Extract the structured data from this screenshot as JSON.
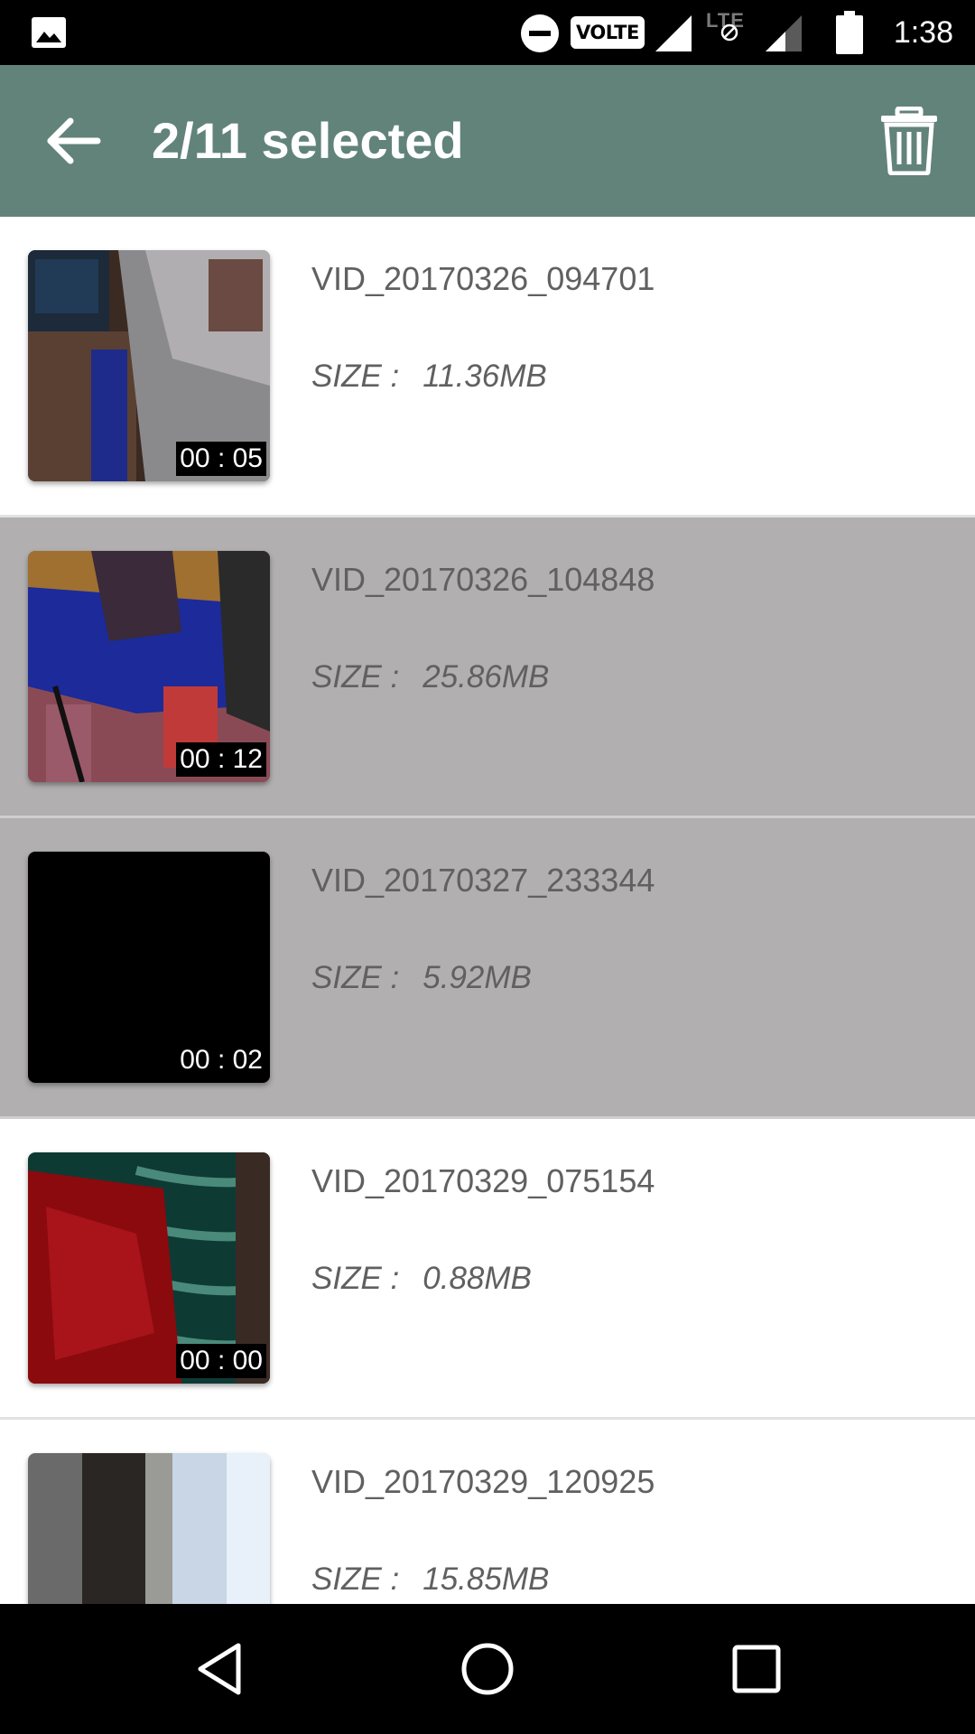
{
  "status_bar": {
    "volte": "VOLTE",
    "lte": "LTE",
    "time": "1:38",
    "icons": [
      "gallery-icon",
      "do-not-disturb-icon",
      "signal-icon",
      "signal-icon",
      "battery-icon"
    ]
  },
  "app_bar": {
    "title": "2/11 selected",
    "color": "#628379",
    "icons": [
      "back-arrow-icon",
      "trash-icon"
    ]
  },
  "selected_color": "#b1afb0",
  "videos": [
    {
      "name": "VID_20170326_094701",
      "size_label": "SIZE :",
      "size": "11.36MB",
      "duration": "00 : 05",
      "selected": false
    },
    {
      "name": "VID_20170326_104848",
      "size_label": "SIZE :",
      "size": "25.86MB",
      "duration": "00 : 12",
      "selected": true
    },
    {
      "name": "VID_20170327_233344",
      "size_label": "SIZE :",
      "size": "5.92MB",
      "duration": "00 : 02",
      "selected": true
    },
    {
      "name": "VID_20170329_075154",
      "size_label": "SIZE :",
      "size": "0.88MB",
      "duration": "00 : 00",
      "selected": false
    },
    {
      "name": "VID_20170329_120925",
      "size_label": "SIZE :",
      "size": "15.85MB",
      "duration": "",
      "selected": false
    }
  ],
  "nav_bar": {
    "icons": [
      "nav-back-icon",
      "nav-home-icon",
      "nav-recents-icon"
    ]
  }
}
